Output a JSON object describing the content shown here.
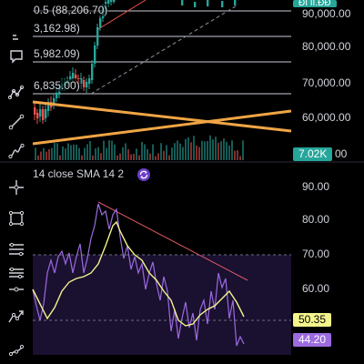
{
  "colors": {
    "background": "#000000",
    "candle_up": "#26a69a",
    "candle_down": "#ef5350",
    "trendline": "#f0a545",
    "rsi_line": "#9c6be0",
    "sma_line": "#f4f48c",
    "rsi_band_fill": "#1a1030",
    "resistance_line": "#e05a6a",
    "badge_green": "#26a69a",
    "badge_yellow": "#f4f48c",
    "badge_purple": "#9c6be0"
  },
  "price_levels": [
    {
      "label": "0.5 (88,206.70)"
    },
    {
      "label": "3,162.98)"
    },
    {
      "label": "5,982.09)"
    },
    {
      "label": "6,835.00)"
    }
  ],
  "price_axis": [
    "90,000.00",
    "80,000.00",
    "70,000.00",
    "60,000.00"
  ],
  "price_axis_partial": "00",
  "volume_badge": "7.02K",
  "top_badge_partial": "ĐĨ ĨĨ.ĐĐ",
  "indicator": {
    "label": "14 close SMA 14 2",
    "axis": [
      "90.00",
      "80.00",
      "70.00",
      "60.00"
    ],
    "sma_value": "50.35",
    "rsi_value": "44.20"
  },
  "tools": [
    {
      "icon": "shapes-icon"
    },
    {
      "icon": "text-note-icon"
    },
    {
      "icon": "pattern-icon"
    },
    {
      "icon": "trend-line-icon"
    },
    {
      "icon": "curve-icon"
    },
    {
      "icon": "crosshair-icon"
    },
    {
      "icon": "rectangle-icon"
    },
    {
      "icon": "fib-levels-icon"
    },
    {
      "icon": "parallel-channel-icon"
    },
    {
      "icon": "horizontal-line-icon"
    },
    {
      "icon": "path-icon"
    },
    {
      "icon": "brush-icon"
    }
  ]
}
